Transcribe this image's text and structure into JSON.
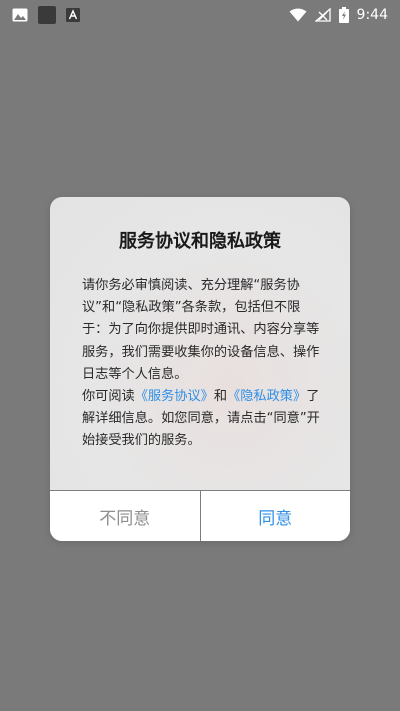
{
  "status_bar": {
    "time": "9:44",
    "icons": [
      "image-icon",
      "square-icon",
      "font-icon",
      "wifi-icon",
      "no-signal-icon",
      "battery-charging-icon"
    ]
  },
  "dialog": {
    "title": "服务协议和隐私政策",
    "paragraph1": "请你务必审慎阅读、充分理解“服务协议”和“隐私政策”各条款，包括但不限于：为了向你提供即时通讯、内容分享等服务，我们需要收集你的设备信息、操作日志等个人信息。",
    "paragraph2_prefix": "你可阅读",
    "service_link": "《服务协议》",
    "paragraph2_and": "和",
    "privacy_link": "《隐私政策》",
    "paragraph2_suffix": "了解详细信息。如您同意，请点击“同意”开始接受我们的服务。",
    "disagree_label": "不同意",
    "agree_label": "同意"
  },
  "colors": {
    "overlay": "#7a7a7a",
    "accent": "#2f8fe8",
    "disagree": "#8e8e8e"
  }
}
